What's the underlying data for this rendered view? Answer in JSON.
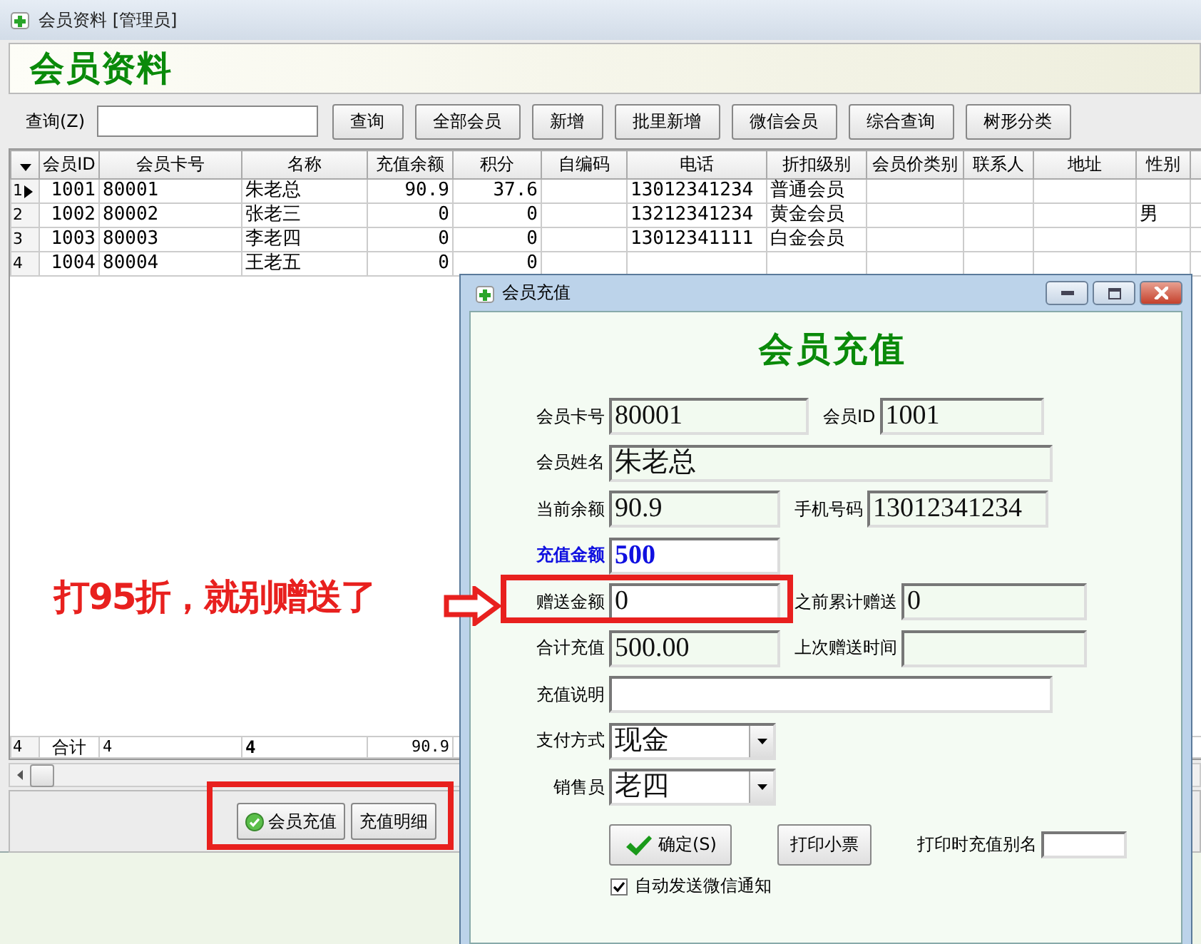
{
  "window": {
    "title": "会员资料 [管理员]"
  },
  "banner": {
    "title": "会员资料"
  },
  "search": {
    "label": "查询(Z)"
  },
  "toolbar": [
    "查询",
    "全部会员",
    "新增",
    "批里新增",
    "微信会员",
    "综合查询",
    "树形分类"
  ],
  "table": {
    "columns": [
      "会员ID",
      "会员卡号",
      "名称",
      "充值余额",
      "积分",
      "自编码",
      "电话",
      "折扣级别",
      "会员价类别",
      "联系人",
      "地址",
      "性别"
    ],
    "rows": [
      {
        "number": "1",
        "selected": true,
        "cells": [
          "1001",
          "80001",
          "朱老总",
          "90.9",
          "37.6",
          null,
          "13012341234",
          "普通会员",
          null,
          null,
          null,
          null
        ]
      },
      {
        "number": "2",
        "selected": false,
        "cells": [
          "1002",
          "80002",
          "张老三",
          "0",
          "0",
          null,
          "13212341234",
          "黄金会员",
          null,
          null,
          null,
          "男"
        ]
      },
      {
        "number": "3",
        "selected": false,
        "cells": [
          "1003",
          "80003",
          "李老四",
          "0",
          "0",
          null,
          "13012341111",
          "白金会员",
          null,
          null,
          null,
          null
        ]
      },
      {
        "number": "4",
        "selected": false,
        "cells": [
          "1004",
          "80004",
          "王老五",
          "0",
          "0",
          null,
          null,
          null,
          null,
          null,
          null,
          null
        ]
      }
    ],
    "totals": {
      "number": "4",
      "label": "合计",
      "cells": [
        "4",
        "4",
        "90.9"
      ]
    }
  },
  "actions": [
    {
      "label": "会员充值",
      "kind": "with-icon"
    },
    {
      "label": "充值明细",
      "kind": "plain"
    }
  ],
  "dialog": {
    "title": "会员充值",
    "heading": "会员充值",
    "rows": [
      {
        "fields": [
          {
            "label": "会员卡号",
            "kind": "text",
            "value": "80001",
            "readonly": true,
            "emphasis": false
          },
          {
            "label": "会员ID",
            "kind": "text",
            "value": "1001",
            "readonly": true,
            "emphasis": false
          }
        ]
      },
      {
        "fields": [
          {
            "label": "会员姓名",
            "kind": "text",
            "value": "朱老总",
            "readonly": true,
            "emphasis": false
          }
        ]
      },
      {
        "fields": [
          {
            "label": "当前余额",
            "kind": "text",
            "value": "90.9",
            "readonly": true,
            "emphasis": false
          },
          {
            "label": "手机号码",
            "kind": "text",
            "value": "13012341234",
            "readonly": true,
            "emphasis": false
          }
        ]
      },
      {
        "fields": [
          {
            "label": "充值金额",
            "kind": "text",
            "value": "500",
            "readonly": false,
            "emphasis": true
          }
        ]
      },
      {
        "fields": [
          {
            "label": "赠送金额",
            "kind": "text",
            "value": "0",
            "readonly": false,
            "emphasis": false
          },
          {
            "label": "之前累计赠送",
            "kind": "text",
            "value": "0",
            "readonly": true,
            "emphasis": false
          }
        ]
      },
      {
        "fields": [
          {
            "label": "合计充值",
            "kind": "text",
            "value": "500.00",
            "readonly": true,
            "emphasis": false
          },
          {
            "label": "上次赠送时间",
            "kind": "text",
            "readonly": true,
            "emphasis": false
          }
        ]
      },
      {
        "fields": [
          {
            "label": "充值说明",
            "kind": "text",
            "readonly": false,
            "emphasis": false
          }
        ]
      },
      {
        "fields": [
          {
            "label": "支付方式",
            "kind": "select",
            "value": "现金",
            "readonly": false,
            "emphasis": false
          }
        ]
      },
      {
        "fields": [
          {
            "label": "销售员",
            "kind": "select",
            "value": "老四",
            "readonly": false,
            "emphasis": false
          }
        ]
      }
    ],
    "buttons": [
      {
        "label": "确定(S)",
        "kind": "confirm"
      },
      {
        "label": "打印小票",
        "kind": "plain"
      }
    ],
    "alias": {
      "label": "打印时充值别名"
    },
    "auto_notify": {
      "label": "自动发送微信通知",
      "checked": true
    }
  },
  "annotation": {
    "note": "打95折，就别赠送了"
  }
}
